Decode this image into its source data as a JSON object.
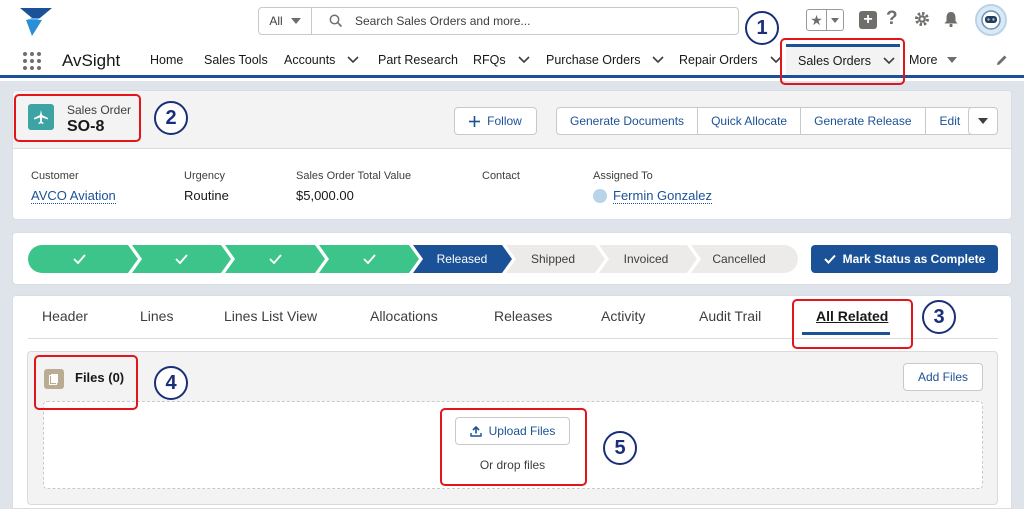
{
  "global_header": {
    "search_scope": "All",
    "search_placeholder": "Search Sales Orders and more..."
  },
  "nav": {
    "app_name": "AvSight",
    "items": [
      "Home",
      "Sales Tools",
      "Accounts",
      "Part Research",
      "RFQs",
      "Purchase Orders",
      "Repair Orders",
      "Sales Orders",
      "More"
    ],
    "active": "Sales Orders"
  },
  "record": {
    "type_label": "Sales Order",
    "name": "SO-8",
    "actions": [
      "Follow",
      "Generate Documents",
      "Quick Allocate",
      "Generate Release",
      "Edit"
    ],
    "fields": [
      {
        "label": "Customer",
        "value": "AVCO Aviation"
      },
      {
        "label": "Urgency",
        "value": "Routine"
      },
      {
        "label": "Sales Order Total Value",
        "value": "$5,000.00"
      },
      {
        "label": "Contact",
        "value": ""
      },
      {
        "label": "Assigned To",
        "value": "Fermin Gonzalez"
      }
    ]
  },
  "path": {
    "stages": [
      "Released",
      "Shipped",
      "Invoiced",
      "Cancelled"
    ],
    "completed_steps": 4,
    "current": "Released",
    "mark_button": "Mark Status as Complete"
  },
  "tabs": {
    "items": [
      "Header",
      "Lines",
      "Lines List View",
      "Allocations",
      "Releases",
      "Activity",
      "Audit Trail",
      "All Related"
    ],
    "active": "All Related"
  },
  "files": {
    "title": "Files (0)",
    "add_button": "Add Files",
    "upload_button": "Upload Files",
    "drop_text": "Or drop files"
  },
  "annotations": [
    "1",
    "2",
    "3",
    "4",
    "5"
  ],
  "colors": {
    "brand_blue": "#1b5297",
    "path_complete": "#3cc48a",
    "path_incomplete": "#ecebea",
    "highlight_red": "#e3151b",
    "record_icon": "#3ea3a3"
  }
}
